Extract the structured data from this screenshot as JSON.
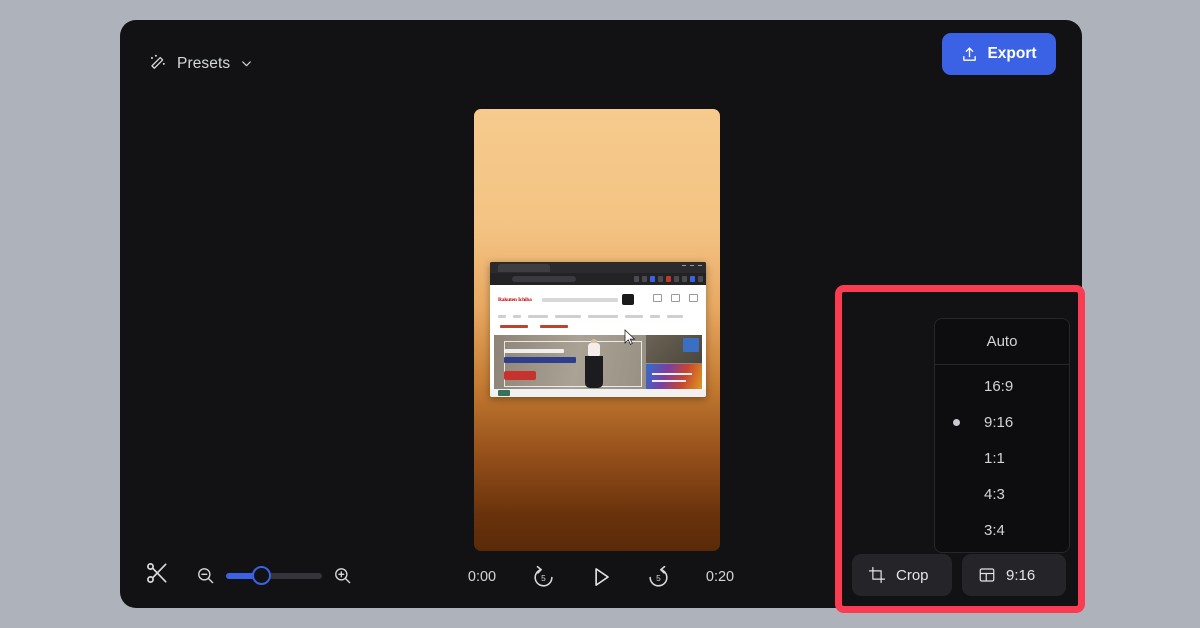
{
  "app": {
    "window_bg": "#121215",
    "page_bg": "#aeb2ba"
  },
  "topbar": {
    "presets_label": "Presets",
    "presets_icon": "magic-wand-icon",
    "chevron_icon": "chevron-down-icon",
    "export_label": "Export",
    "export_icon": "upload-icon",
    "export_color": "#3b62e4"
  },
  "preview": {
    "aspect": "9:16",
    "background_top_color": "#f6cb8d",
    "background_bottom_color": "#5a2a08",
    "screenshot": {
      "brand": "Rakuten Ichiba",
      "cursor_icon": "mouse-pointer-icon"
    }
  },
  "bottombar": {
    "cut_icon": "scissors-icon",
    "zoom_out_icon": "zoom-out-icon",
    "zoom_in_icon": "zoom-in-icon",
    "slider_value": 38,
    "slider_accent": "#3b62e4",
    "current_time": "0:00",
    "total_time": "0:20",
    "rewind_icon": "rewind-5-icon",
    "rewind_label": "5",
    "play_icon": "play-icon",
    "forward_icon": "forward-5-icon",
    "forward_label": "5"
  },
  "highlight": {
    "border_color": "#fb3b52",
    "dropdown": {
      "header_label": "Auto",
      "items": [
        {
          "label": "16:9",
          "selected": false
        },
        {
          "label": "9:16",
          "selected": true
        },
        {
          "label": "1:1",
          "selected": false
        },
        {
          "label": "4:3",
          "selected": false
        },
        {
          "label": "3:4",
          "selected": false
        }
      ]
    },
    "buttons": {
      "crop_label": "Crop",
      "crop_icon": "crop-icon",
      "ratio_label": "9:16",
      "ratio_icon": "layout-grid-icon"
    }
  }
}
